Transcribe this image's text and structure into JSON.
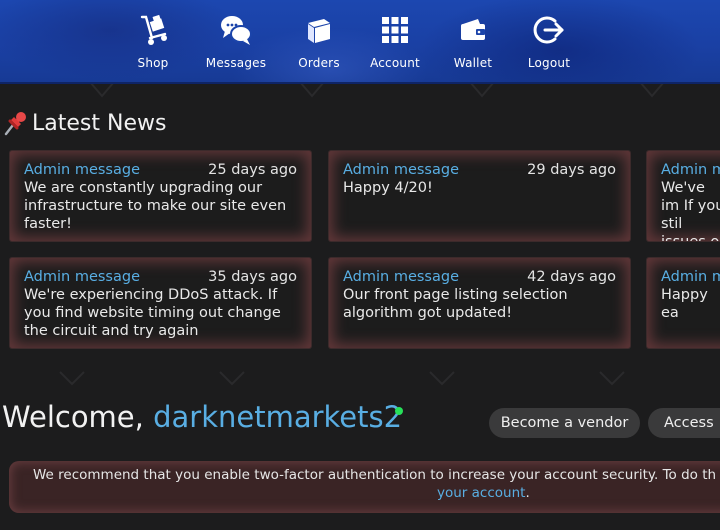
{
  "nav": {
    "items": [
      {
        "label": "Shop",
        "icon": "trolley-icon"
      },
      {
        "label": "Messages",
        "icon": "chat-bubbles-icon"
      },
      {
        "label": "Orders",
        "icon": "box-icon"
      },
      {
        "label": "Account",
        "icon": "grid-icon"
      },
      {
        "label": "Wallet",
        "icon": "wallet-icon"
      },
      {
        "label": "Logout",
        "icon": "logout-icon"
      }
    ]
  },
  "news": {
    "title": "Latest News",
    "cards": [
      {
        "from": "Admin message",
        "ago": "25 days ago",
        "text": "We are constantly upgrading our infrastructure to make our site even faster!"
      },
      {
        "from": "Admin message",
        "ago": "29 days ago",
        "text": "Happy 4/20!"
      },
      {
        "from": "Admin me",
        "ago": "",
        "text": "We've im If you stil issues o"
      },
      {
        "from": "Admin message",
        "ago": "35 days ago",
        "text": "We're experiencing DDoS attack. If you find website timing out change the circuit and try again"
      },
      {
        "from": "Admin message",
        "ago": "42 days ago",
        "text": "Our front page listing selection algorithm got updated!"
      },
      {
        "from": "Admin me",
        "ago": "",
        "text": "Happy ea"
      }
    ]
  },
  "welcome": {
    "prefix": "Welcome, ",
    "username": "darknetmarkets2",
    "become_vendor": "Become a vendor",
    "access": "Access"
  },
  "alert": {
    "line1": "We recommend that you enable two-factor authentication to increase your account security. To do th",
    "link": "your account",
    "period": "."
  },
  "colors": {
    "nav_bg": "#1c47b0",
    "page_bg": "#1c1c1d",
    "link": "#59aee3",
    "online": "#27e05a",
    "alert_bg": "#3a2425"
  }
}
